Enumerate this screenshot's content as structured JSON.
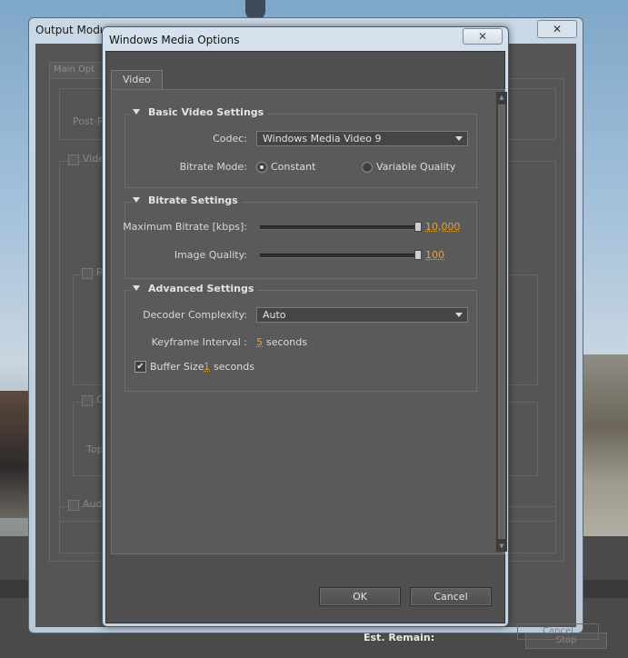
{
  "background_window": {
    "title": "Output Modu",
    "close_icon": "close-icon",
    "tab_label": "Main Opt",
    "post_label": "Post-R",
    "video_checkbox_label": "Vide",
    "resize_label": "R",
    "crop_label": "C",
    "top_label": "Top",
    "audio_label": "Audi",
    "cancel_label": "Cancel"
  },
  "taskbar": {
    "est_remain_label": "Est. Remain:",
    "stop_label": "Stop"
  },
  "dialog": {
    "title": "Windows Media Options",
    "close_icon": "close-icon",
    "tab_label": "Video",
    "basic": {
      "header": "Basic Video Settings",
      "codec_label": "Codec:",
      "codec_value": "Windows Media Video 9",
      "bitrate_mode_label": "Bitrate Mode:",
      "constant_label": "Constant",
      "variable_label": "Variable Quality",
      "selected_mode": "Constant"
    },
    "bitrate": {
      "header": "Bitrate Settings",
      "max_bitrate_label": "Maximum Bitrate [kbps]:",
      "max_bitrate_value": "10,000",
      "max_bitrate_level": 1.0,
      "image_quality_label": "Image Quality:",
      "image_quality_value": "100",
      "image_quality_level": 1.0
    },
    "advanced": {
      "header": "Advanced Settings",
      "decoder_label": "Decoder Complexity:",
      "decoder_value": "Auto",
      "keyframe_label": "Keyframe Interval :",
      "keyframe_value": "5",
      "keyframe_unit": "seconds",
      "buffer_label": "Buffer Size",
      "buffer_checked": true,
      "buffer_value": "1",
      "buffer_unit": "seconds"
    },
    "ok_label": "OK",
    "cancel_label": "Cancel"
  },
  "colors": {
    "accent_value": "#e0a23a",
    "panel_bg": "#5a5a5a"
  }
}
